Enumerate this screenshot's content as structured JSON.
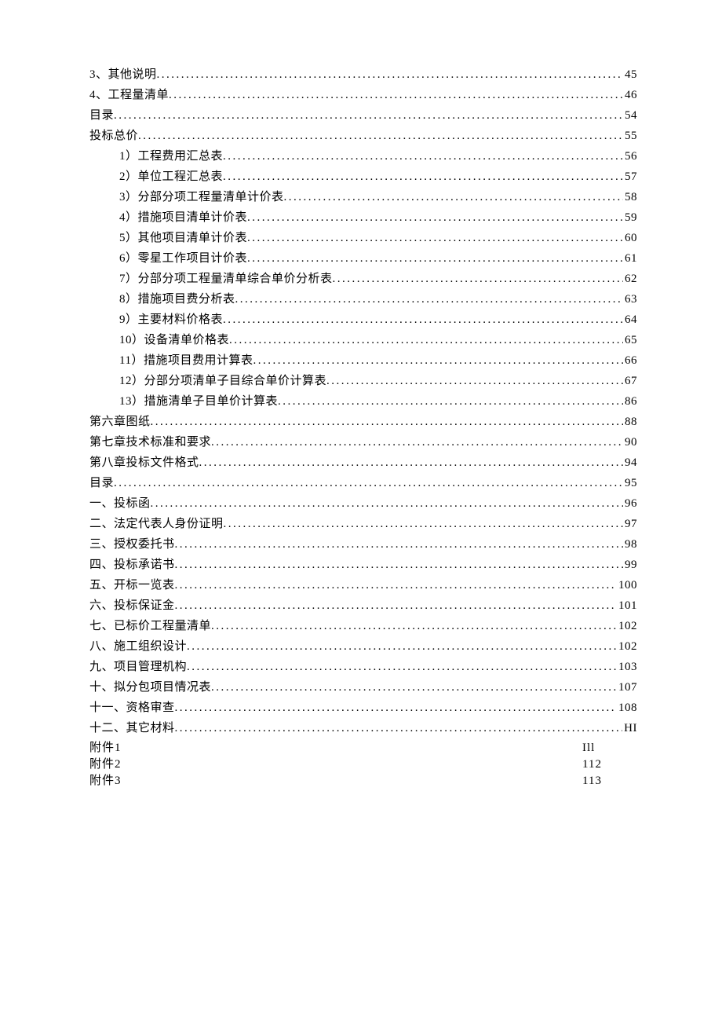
{
  "toc": [
    {
      "title": "3、其他说明",
      "page": "45",
      "indent": false
    },
    {
      "title": "4、工程量清单",
      "page": "46",
      "indent": false
    },
    {
      "title": "目录",
      "page": "54",
      "indent": false
    },
    {
      "title": "投标总价",
      "page": "55",
      "indent": false
    },
    {
      "title": "1）工程费用汇总表",
      "page": "56",
      "indent": true
    },
    {
      "title": "2）单位工程汇总表",
      "page": "57",
      "indent": true
    },
    {
      "title": "3）分部分项工程量清单计价表",
      "page": "58",
      "indent": true
    },
    {
      "title": "4）措施项目清单计价表",
      "page": "59",
      "indent": true
    },
    {
      "title": "5）其他项目清单计价表",
      "page": "60",
      "indent": true
    },
    {
      "title": "6）零星工作项目计价表",
      "page": "61",
      "indent": true
    },
    {
      "title": "7）分部分项工程量清单综合单价分析表",
      "page": "62",
      "indent": true
    },
    {
      "title": "8）措施项目费分析表",
      "page": "63",
      "indent": true
    },
    {
      "title": "9）主要材料价格表",
      "page": "64",
      "indent": true
    },
    {
      "title": "10）设备清单价格表",
      "page": "65",
      "indent": true
    },
    {
      "title": "11）措施项目费用计算表",
      "page": "66",
      "indent": true
    },
    {
      "title": "12）分部分项清单子目综合单价计算表",
      "page": "67",
      "indent": true
    },
    {
      "title": "13）措施清单子目单价计算表",
      "page": "86",
      "indent": true
    },
    {
      "title": "第六章图纸",
      "page": "88",
      "indent": false
    },
    {
      "title": "第七章技术标准和要求",
      "page": "90",
      "indent": false
    },
    {
      "title": "第八章投标文件格式",
      "page": "94",
      "indent": false
    },
    {
      "title": "目录",
      "page": "95",
      "indent": false
    },
    {
      "title": "一、投标函",
      "page": "96",
      "indent": false
    },
    {
      "title": "二、法定代表人身份证明",
      "page": "97",
      "indent": false
    },
    {
      "title": "三、授权委托书",
      "page": "98",
      "indent": false
    },
    {
      "title": "四、投标承诺书",
      "page": "99",
      "indent": false
    },
    {
      "title": "五、开标一览表",
      "page": "100",
      "indent": false
    },
    {
      "title": "六、投标保证金",
      "page": "101",
      "indent": false
    },
    {
      "title": "七、已标价工程量清单",
      "page": "102",
      "indent": false
    },
    {
      "title": "八、施工组织设计",
      "page": "102",
      "indent": false
    },
    {
      "title": "九、项目管理机构",
      "page": "103",
      "indent": false
    },
    {
      "title": "十、拟分包项目情况表",
      "page": "107",
      "indent": false
    },
    {
      "title": "十一、资格审查",
      "page": "108",
      "indent": false
    },
    {
      "title": "十二、其它材料",
      "page": "HI",
      "indent": false
    }
  ],
  "attachments": [
    {
      "label": "附件1",
      "page": "Ill"
    },
    {
      "label": "附件2",
      "page": "112"
    },
    {
      "label": "附件3",
      "page": "113"
    }
  ]
}
